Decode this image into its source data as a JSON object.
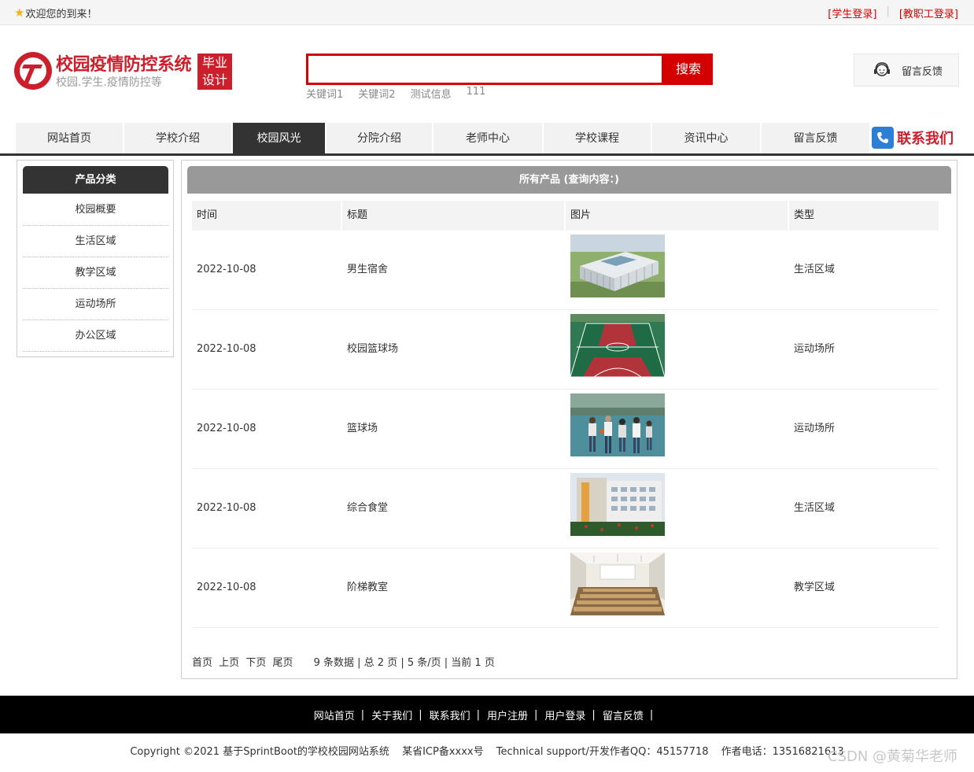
{
  "topbar": {
    "welcome": "欢迎您的到来！",
    "student_login": "[学生登录]",
    "staff_login": "[教职工登录]"
  },
  "header": {
    "title": "校园疫情防控系统",
    "subtitle": "校园.学生.疫情防控等",
    "badge_line1": "毕业",
    "badge_line2": "设计",
    "search_value": "",
    "search_button": "搜索",
    "hot_keywords": [
      "关键词1",
      "关键词2",
      "测试信息",
      "111"
    ],
    "feedback_button": "留言反馈"
  },
  "nav": {
    "items": [
      "网站首页",
      "学校介绍",
      "校园风光",
      "分院介绍",
      "老师中心",
      "学校课程",
      "资讯中心",
      "留言反馈"
    ],
    "active": "校园风光",
    "contact": "联系我们"
  },
  "sidebar": {
    "title": "产品分类",
    "items": [
      "校园概要",
      "生活区域",
      "教学区域",
      "运动场所",
      "办公区域"
    ]
  },
  "main": {
    "title": "所有产品 (查询内容：)",
    "columns": [
      "时间",
      "标题",
      "图片",
      "类型"
    ],
    "rows": [
      {
        "date": "2022-10-08",
        "title": "男生宿舍",
        "image": "building-photo",
        "type": "生活区域"
      },
      {
        "date": "2022-10-08",
        "title": "校园篮球场",
        "image": "court-photo",
        "type": "运动场所"
      },
      {
        "date": "2022-10-08",
        "title": "篮球场",
        "image": "players-photo",
        "type": "运动场所"
      },
      {
        "date": "2022-10-08",
        "title": "综合食堂",
        "image": "canteen-photo",
        "type": "生活区域"
      },
      {
        "date": "2022-10-08",
        "title": "阶梯教室",
        "image": "lecture-hall-photo",
        "type": "教学区域"
      }
    ],
    "pager": {
      "first": "首页",
      "prev": "上页",
      "next": "下页",
      "last": "尾页",
      "info": "9 条数据 | 总 2 页 | 5 条/页 | 当前 1 页"
    }
  },
  "footer": {
    "links": [
      "网站首页",
      "关于我们",
      "联系我们",
      "用户注册",
      "用户登录",
      "留言反馈"
    ],
    "separator": "|",
    "copyright": "Copyright ©2021 基于SprintBoot的学校校园网站系统",
    "icp": "某省ICP备xxxx号",
    "support": "Technical support/开发作者QQ：45157718",
    "phone": "作者电话：13516821613",
    "watermark": "CSDN @黄菊华老师"
  },
  "colors": {
    "brand_red": "#cc1f2c",
    "search_red": "#d40000",
    "nav_dark": "#333333",
    "panel_gray": "#999999"
  }
}
